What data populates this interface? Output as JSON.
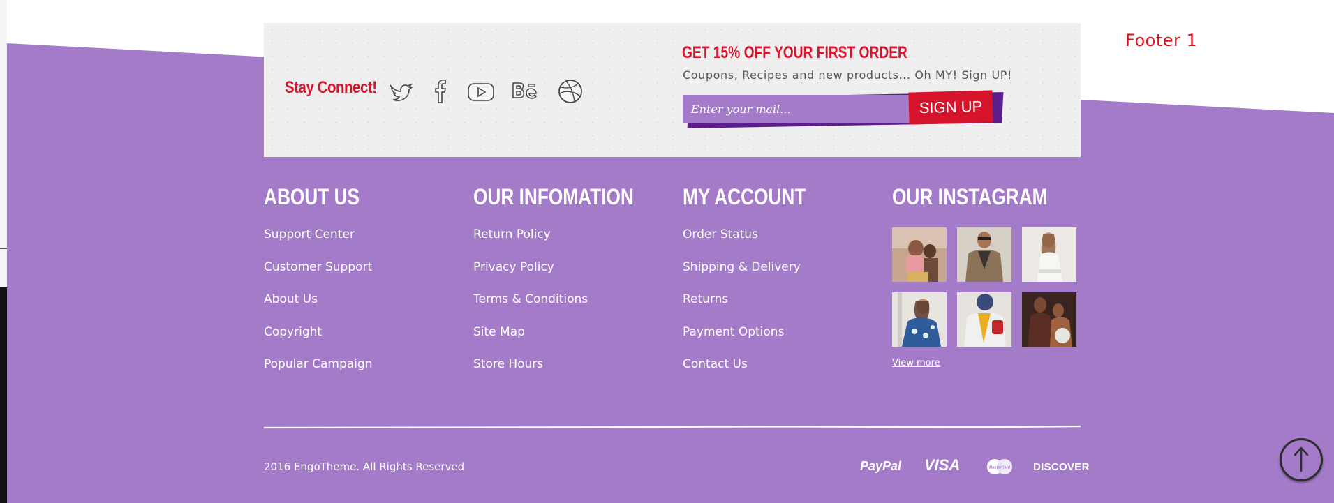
{
  "label": "Footer 1",
  "colors": {
    "purple": "#a47bc9",
    "red": "#d5132a",
    "dark_purple": "#5b1e8a",
    "box": "#efefef"
  },
  "stay_connect": {
    "title": "Stay Connect!",
    "icons": [
      "twitter-icon",
      "facebook-icon",
      "youtube-icon",
      "behance-icon",
      "dribbble-icon"
    ]
  },
  "promo": {
    "title": "GET 15% OFF YOUR FIRST ORDER",
    "subtitle": "Coupons, Recipes and new products... Oh MY! Sign UP!",
    "email_placeholder": "Enter your mail...",
    "button": "SIGN UP"
  },
  "columns": [
    {
      "title": "ABOUT US",
      "links": [
        "Support Center",
        "Customer Support",
        "About Us",
        "Copyright",
        "Popular Campaign"
      ]
    },
    {
      "title": "OUR INFOMATION",
      "links": [
        "Return Policy",
        "Privacy Policy",
        "Terms & Conditions",
        "Site Map",
        "Store Hours"
      ]
    },
    {
      "title": "MY ACCOUNT",
      "links": [
        "Order Status",
        "Shipping & Delivery",
        "Returns",
        "Payment Options",
        "Contact Us"
      ]
    }
  ],
  "instagram": {
    "title": "OUR INSTAGRAM",
    "view_more": "View more"
  },
  "bottom": {
    "copyright": "2016 EngoTheme. All Rights Reserved",
    "payments": [
      "PayPal",
      "VISA",
      "MasterCard",
      "DISCOVER"
    ]
  }
}
